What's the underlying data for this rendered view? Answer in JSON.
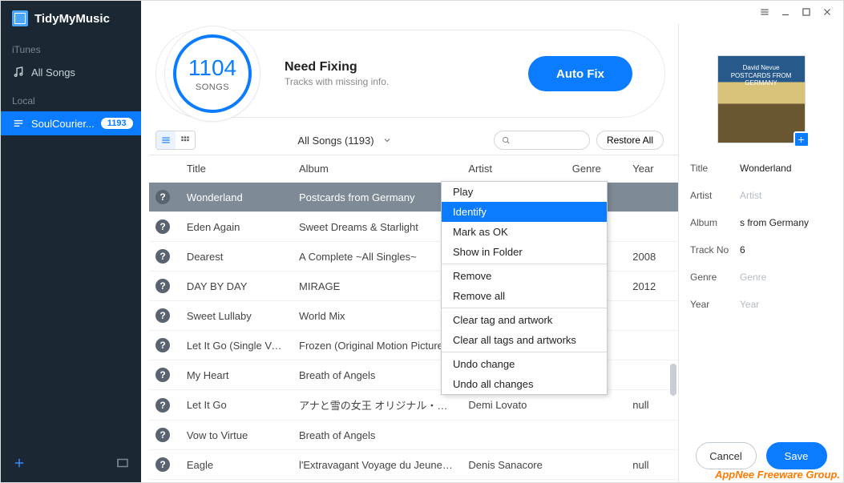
{
  "app_name": "TidyMyMusic",
  "sidebar": {
    "section1": "iTunes",
    "all_songs": "All Songs",
    "section2": "Local",
    "local_item": "SoulCourier...",
    "local_badge": "1193"
  },
  "summary": {
    "count": "1104",
    "unit": "SONGS",
    "title": "Need Fixing",
    "sub": "Tracks with missing info.",
    "autofix": "Auto Fix"
  },
  "toolbar": {
    "filter": "All Songs (1193)",
    "restore": "Restore All",
    "search_placeholder": ""
  },
  "columns": {
    "title": "Title",
    "album": "Album",
    "artist": "Artist",
    "genre": "Genre",
    "year": "Year"
  },
  "rows": [
    {
      "title": "Wonderland",
      "album": "Postcards from Germany",
      "artist": "",
      "genre": "",
      "year": ""
    },
    {
      "title": "Eden Again",
      "album": "Sweet Dreams & Starlight",
      "artist": "",
      "genre": "",
      "year": ""
    },
    {
      "title": "Dearest",
      "album": "A Complete ~All Singles~",
      "artist": "",
      "genre": "",
      "year": "2008"
    },
    {
      "title": "DAY BY DAY",
      "album": "MIRAGE",
      "artist": "",
      "genre": "",
      "year": "2012"
    },
    {
      "title": "Sweet Lullaby",
      "album": "World Mix",
      "artist": "",
      "genre": "",
      "year": ""
    },
    {
      "title": "Let It Go (Single Version",
      "album": "Frozen (Original Motion Picture Soundtr",
      "artist": "",
      "genre": "",
      "year": ""
    },
    {
      "title": "My Heart",
      "album": "Breath of Angels",
      "artist": "",
      "genre": "",
      "year": ""
    },
    {
      "title": "Let It Go",
      "album": "アナと雪の女王 オリジナル・サウンドトラック",
      "artist": "Demi Lovato",
      "genre": "",
      "year": "null"
    },
    {
      "title": "Vow to Virtue",
      "album": "Breath of Angels",
      "artist": "",
      "genre": "",
      "year": ""
    },
    {
      "title": "Eagle",
      "album": "l'Extravagant Voyage du Jeune et Prodig",
      "artist": "Denis Sanacore",
      "genre": "",
      "year": "null"
    }
  ],
  "context_menu": {
    "items": [
      "Play",
      "Identify",
      "Mark as OK",
      "Show in Folder",
      "Remove",
      "Remove all",
      "Clear tag and artwork",
      "Clear all tags and artworks",
      "Undo change",
      "Undo all changes"
    ],
    "separators_after": [
      3,
      5,
      7
    ]
  },
  "details": {
    "art_label_top": "David Nevue",
    "art_label_sub": "POSTCARDS FROM GERMANY",
    "fields": {
      "title_lbl": "Title",
      "title_val": "Wonderland",
      "artist_lbl": "Artist",
      "artist_val": "Artist",
      "album_lbl": "Album",
      "album_val": "s from Germany",
      "track_lbl": "Track No",
      "track_val": "6",
      "genre_lbl": "Genre",
      "genre_val": "Genre",
      "year_lbl": "Year",
      "year_val": "Year"
    },
    "cancel": "Cancel",
    "save": "Save"
  },
  "watermark": "AppNee Freeware Group."
}
